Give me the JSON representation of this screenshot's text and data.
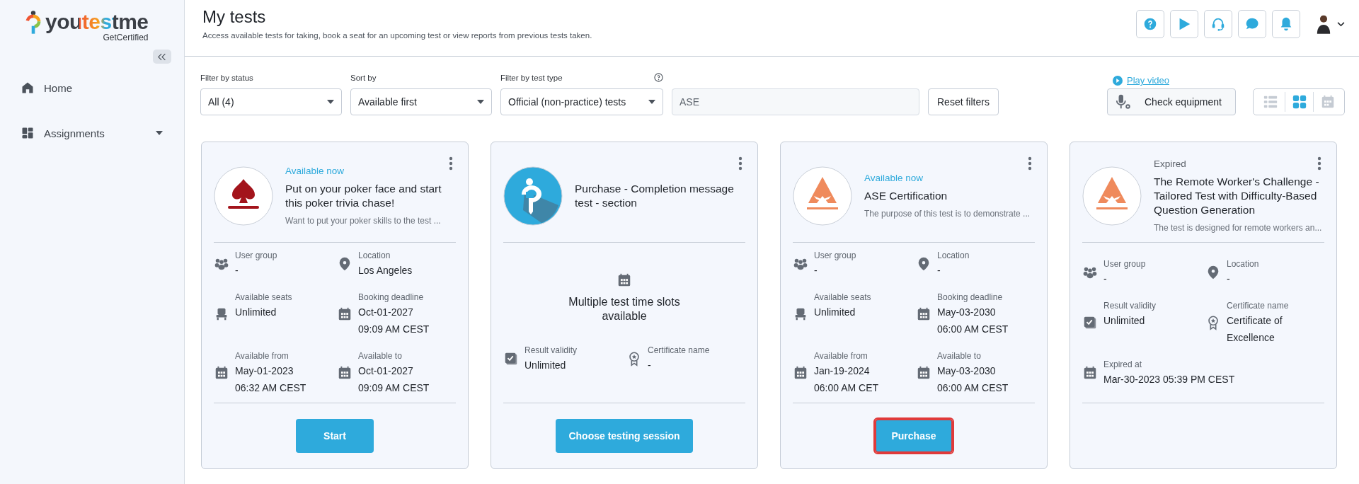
{
  "sidebar": {
    "brand": "youtestme",
    "tagline": "GetCertified",
    "nav": [
      {
        "label": "Home",
        "kind": "home",
        "expandable": false
      },
      {
        "label": "Assignments",
        "kind": "assignments",
        "expandable": true
      }
    ]
  },
  "header": {
    "title": "My tests",
    "subtitle": "Access available tests for taking, book a seat for an upcoming test or view reports from previous tests taken."
  },
  "filters": [
    {
      "label": "Filter by status",
      "value": "All (4)",
      "help": false
    },
    {
      "label": "Sort by",
      "value": "Available first",
      "help": false
    },
    {
      "label": "Filter by test type",
      "value": "Official (non-practice) tests",
      "help": true
    }
  ],
  "search": {
    "value": "ASE"
  },
  "reset_button": "Reset filters",
  "play_video": "Play video",
  "check_equipment": "Check equipment",
  "view_modes": [
    {
      "kind": "list",
      "selected": false
    },
    {
      "kind": "grid",
      "selected": true
    },
    {
      "kind": "calendar",
      "selected": false
    }
  ],
  "cards": [
    {
      "logo": {
        "kind": "spade"
      },
      "status": {
        "text": "Available now",
        "kind": "available"
      },
      "title": "Put on your poker face and start this poker trivia chase!",
      "description": "Want to put your poker skills to the test ...",
      "details": [
        {
          "kind": "group",
          "label": "User group",
          "value": "-"
        },
        {
          "kind": "location",
          "label": "Location",
          "value": "Los Angeles"
        },
        {
          "kind": "seats",
          "label": "Available seats",
          "value": "Unlimited"
        },
        {
          "kind": "date",
          "label": "Booking deadline",
          "value": "Oct-01-2027 09:09 AM CEST"
        },
        {
          "kind": "date",
          "label": "Available from",
          "value": "May-01-2023 06:32 AM CEST"
        },
        {
          "kind": "date",
          "label": "Available to",
          "value": "Oct-01-2027 09:09 AM CEST"
        }
      ],
      "button": {
        "label": "Start",
        "highlighted": false
      }
    },
    {
      "logo": {
        "kind": "info"
      },
      "title": "Purchase - Completion message test - section",
      "slots_message": "Multiple test time slots available",
      "details": [
        {
          "kind": "validity",
          "label": "Result validity",
          "value": "Unlimited"
        },
        {
          "kind": "certificate",
          "label": "Certificate name",
          "value": "-"
        }
      ],
      "button": {
        "label": "Choose testing session",
        "highlighted": false
      }
    },
    {
      "logo": {
        "kind": "peak"
      },
      "status": {
        "text": "Available now",
        "kind": "available"
      },
      "title": "ASE Certification",
      "description": "The purpose of this test is to demonstrate ...",
      "details": [
        {
          "kind": "group",
          "label": "User group",
          "value": "-"
        },
        {
          "kind": "location",
          "label": "Location",
          "value": "-"
        },
        {
          "kind": "seats",
          "label": "Available seats",
          "value": "Unlimited"
        },
        {
          "kind": "date",
          "label": "Booking deadline",
          "value": "May-03-2030 06:00 AM CEST"
        },
        {
          "kind": "date",
          "label": "Available from",
          "value": "Jan-19-2024 06:00 AM CET"
        },
        {
          "kind": "date",
          "label": "Available to",
          "value": "May-03-2030 06:00 AM CEST"
        }
      ],
      "button": {
        "label": "Purchase",
        "highlighted": true
      }
    },
    {
      "logo": {
        "kind": "peak"
      },
      "status": {
        "text": "Expired",
        "kind": "expired"
      },
      "title": "The Remote Worker's Challenge - Tailored Test with Difficulty-Based Question Generation",
      "description": "The test is designed for remote workers an...",
      "details": [
        {
          "kind": "group",
          "label": "User group",
          "value": "-"
        },
        {
          "kind": "location",
          "label": "Location",
          "value": "-"
        },
        {
          "kind": "validity",
          "label": "Result validity",
          "value": "Unlimited"
        },
        {
          "kind": "certificate",
          "label": "Certificate name",
          "value": "Certificate of Excellence"
        },
        {
          "kind": "date",
          "label": "Expired at",
          "value": "Mar-30-2023 05:39 PM CEST",
          "wide": true
        }
      ]
    }
  ]
}
